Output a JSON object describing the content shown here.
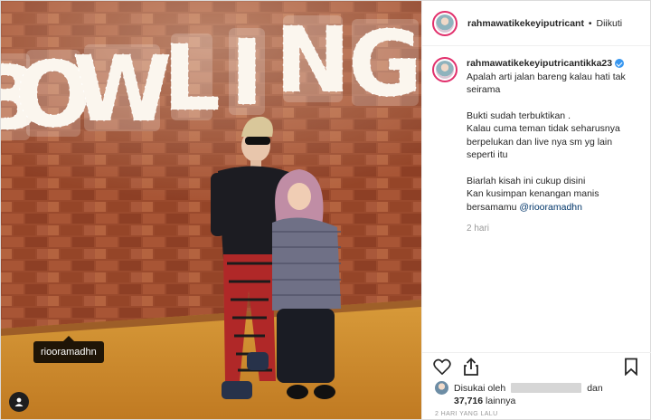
{
  "header": {
    "username": "rahmawatikekeyiputricant",
    "separator": "•",
    "follow_status": "Diikuti"
  },
  "caption": {
    "username": "rahmawatikekeyiputricantikka23",
    "lines_1": [
      "Apalah arti jalan bareng kalau hati tak",
      "seirama"
    ],
    "lines_2": [
      "Bukti sudah terbuktikan .",
      "Kalau cuma teman tidak seharusnya",
      "berpelukan dan live nya sm yg lain",
      "seperti itu"
    ],
    "lines_3": [
      "Biarlah kisah ini cukup disini",
      "Kan kusimpan kenangan manis"
    ],
    "last_line_prefix": "bersamamu ",
    "mention": "@riooramadhn",
    "time_ago": "2 hari"
  },
  "photo": {
    "sign_letters": [
      "B",
      "O",
      "W",
      "L",
      "I",
      "N",
      "G"
    ],
    "user_tag": "riooramadhn"
  },
  "likes": {
    "liked_by_prefix": "Disukai oleh",
    "and": "dan",
    "count": "37,716",
    "others": " lainnya"
  },
  "timestamp": "2 HARI YANG LALU",
  "colors": {
    "link": "#003569",
    "verified": "#3897f0",
    "story_ring": "#e1306c"
  },
  "icons": [
    "heart-icon",
    "share-icon",
    "bookmark-icon",
    "user-tag-icon",
    "verified-badge-icon"
  ]
}
